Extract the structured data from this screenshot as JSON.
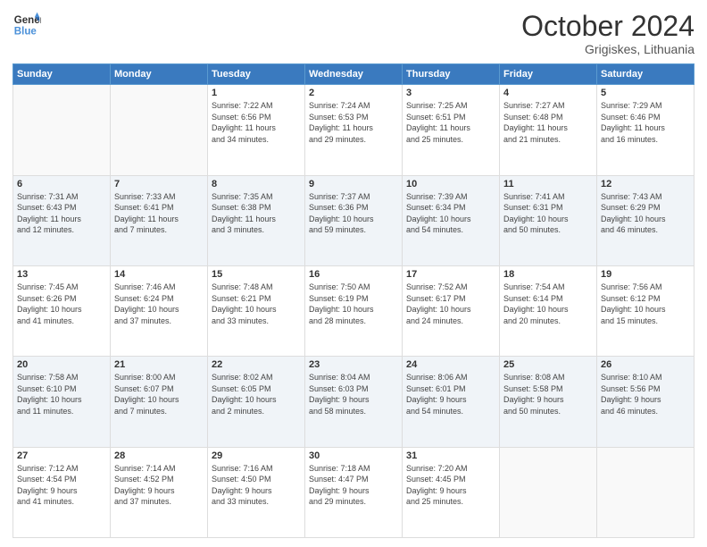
{
  "header": {
    "logo_line1": "General",
    "logo_line2": "Blue",
    "month": "October 2024",
    "location": "Grigiskes, Lithuania"
  },
  "days_of_week": [
    "Sunday",
    "Monday",
    "Tuesday",
    "Wednesday",
    "Thursday",
    "Friday",
    "Saturday"
  ],
  "weeks": [
    [
      {
        "day": "",
        "info": ""
      },
      {
        "day": "",
        "info": ""
      },
      {
        "day": "1",
        "info": "Sunrise: 7:22 AM\nSunset: 6:56 PM\nDaylight: 11 hours\nand 34 minutes."
      },
      {
        "day": "2",
        "info": "Sunrise: 7:24 AM\nSunset: 6:53 PM\nDaylight: 11 hours\nand 29 minutes."
      },
      {
        "day": "3",
        "info": "Sunrise: 7:25 AM\nSunset: 6:51 PM\nDaylight: 11 hours\nand 25 minutes."
      },
      {
        "day": "4",
        "info": "Sunrise: 7:27 AM\nSunset: 6:48 PM\nDaylight: 11 hours\nand 21 minutes."
      },
      {
        "day": "5",
        "info": "Sunrise: 7:29 AM\nSunset: 6:46 PM\nDaylight: 11 hours\nand 16 minutes."
      }
    ],
    [
      {
        "day": "6",
        "info": "Sunrise: 7:31 AM\nSunset: 6:43 PM\nDaylight: 11 hours\nand 12 minutes."
      },
      {
        "day": "7",
        "info": "Sunrise: 7:33 AM\nSunset: 6:41 PM\nDaylight: 11 hours\nand 7 minutes."
      },
      {
        "day": "8",
        "info": "Sunrise: 7:35 AM\nSunset: 6:38 PM\nDaylight: 11 hours\nand 3 minutes."
      },
      {
        "day": "9",
        "info": "Sunrise: 7:37 AM\nSunset: 6:36 PM\nDaylight: 10 hours\nand 59 minutes."
      },
      {
        "day": "10",
        "info": "Sunrise: 7:39 AM\nSunset: 6:34 PM\nDaylight: 10 hours\nand 54 minutes."
      },
      {
        "day": "11",
        "info": "Sunrise: 7:41 AM\nSunset: 6:31 PM\nDaylight: 10 hours\nand 50 minutes."
      },
      {
        "day": "12",
        "info": "Sunrise: 7:43 AM\nSunset: 6:29 PM\nDaylight: 10 hours\nand 46 minutes."
      }
    ],
    [
      {
        "day": "13",
        "info": "Sunrise: 7:45 AM\nSunset: 6:26 PM\nDaylight: 10 hours\nand 41 minutes."
      },
      {
        "day": "14",
        "info": "Sunrise: 7:46 AM\nSunset: 6:24 PM\nDaylight: 10 hours\nand 37 minutes."
      },
      {
        "day": "15",
        "info": "Sunrise: 7:48 AM\nSunset: 6:21 PM\nDaylight: 10 hours\nand 33 minutes."
      },
      {
        "day": "16",
        "info": "Sunrise: 7:50 AM\nSunset: 6:19 PM\nDaylight: 10 hours\nand 28 minutes."
      },
      {
        "day": "17",
        "info": "Sunrise: 7:52 AM\nSunset: 6:17 PM\nDaylight: 10 hours\nand 24 minutes."
      },
      {
        "day": "18",
        "info": "Sunrise: 7:54 AM\nSunset: 6:14 PM\nDaylight: 10 hours\nand 20 minutes."
      },
      {
        "day": "19",
        "info": "Sunrise: 7:56 AM\nSunset: 6:12 PM\nDaylight: 10 hours\nand 15 minutes."
      }
    ],
    [
      {
        "day": "20",
        "info": "Sunrise: 7:58 AM\nSunset: 6:10 PM\nDaylight: 10 hours\nand 11 minutes."
      },
      {
        "day": "21",
        "info": "Sunrise: 8:00 AM\nSunset: 6:07 PM\nDaylight: 10 hours\nand 7 minutes."
      },
      {
        "day": "22",
        "info": "Sunrise: 8:02 AM\nSunset: 6:05 PM\nDaylight: 10 hours\nand 2 minutes."
      },
      {
        "day": "23",
        "info": "Sunrise: 8:04 AM\nSunset: 6:03 PM\nDaylight: 9 hours\nand 58 minutes."
      },
      {
        "day": "24",
        "info": "Sunrise: 8:06 AM\nSunset: 6:01 PM\nDaylight: 9 hours\nand 54 minutes."
      },
      {
        "day": "25",
        "info": "Sunrise: 8:08 AM\nSunset: 5:58 PM\nDaylight: 9 hours\nand 50 minutes."
      },
      {
        "day": "26",
        "info": "Sunrise: 8:10 AM\nSunset: 5:56 PM\nDaylight: 9 hours\nand 46 minutes."
      }
    ],
    [
      {
        "day": "27",
        "info": "Sunrise: 7:12 AM\nSunset: 4:54 PM\nDaylight: 9 hours\nand 41 minutes."
      },
      {
        "day": "28",
        "info": "Sunrise: 7:14 AM\nSunset: 4:52 PM\nDaylight: 9 hours\nand 37 minutes."
      },
      {
        "day": "29",
        "info": "Sunrise: 7:16 AM\nSunset: 4:50 PM\nDaylight: 9 hours\nand 33 minutes."
      },
      {
        "day": "30",
        "info": "Sunrise: 7:18 AM\nSunset: 4:47 PM\nDaylight: 9 hours\nand 29 minutes."
      },
      {
        "day": "31",
        "info": "Sunrise: 7:20 AM\nSunset: 4:45 PM\nDaylight: 9 hours\nand 25 minutes."
      },
      {
        "day": "",
        "info": ""
      },
      {
        "day": "",
        "info": ""
      }
    ]
  ]
}
